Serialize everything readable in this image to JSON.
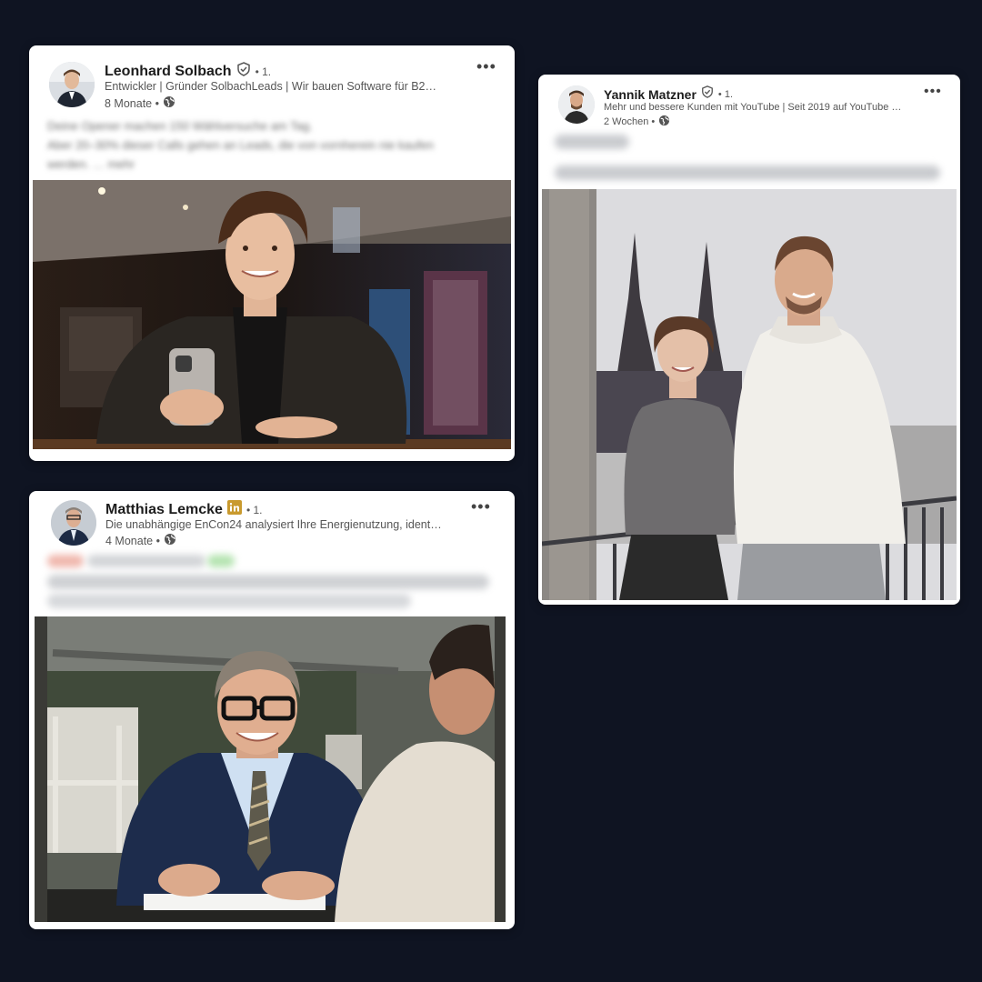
{
  "posts": [
    {
      "author": "Leonhard Solbach",
      "badge": "verified",
      "degree": "• 1.",
      "headline": "Entwickler | Gründer SolbachLeads | Wir bauen Software für B2…",
      "time": "8 Monate •",
      "visibility_icon": "globe-icon",
      "blurred_text": [
        "Deine Opener machen 150 Wählversuche am Tag.",
        "Aber 20–30% dieser Calls gehen an Leads, die von vornherein nie kaufen",
        "werden. … mehr"
      ],
      "menu_icon": "more-options-icon"
    },
    {
      "author": "Yannik Matzner",
      "badge": "verified",
      "degree": "• 1.",
      "headline": "Mehr und bessere Kunden mit YouTube | Seit 2019 auf YouTube …",
      "time": "2 Wochen •",
      "visibility_icon": "globe-icon",
      "menu_icon": "more-options-icon"
    },
    {
      "author": "Matthias Lemcke",
      "badge": "linkedin-premium",
      "degree": "• 1.",
      "headline": "Die unabhängige EnCon24 analysiert Ihre Energienutzung, ident…",
      "time": "4 Monate •",
      "visibility_icon": "globe-icon",
      "menu_icon": "more-options-icon"
    }
  ],
  "colors": {
    "background": "#0f1422",
    "card": "#ffffff",
    "premium_badge": "#c99a2e",
    "blur_green": "#8fd18a",
    "blur_red": "#e39a8f"
  }
}
